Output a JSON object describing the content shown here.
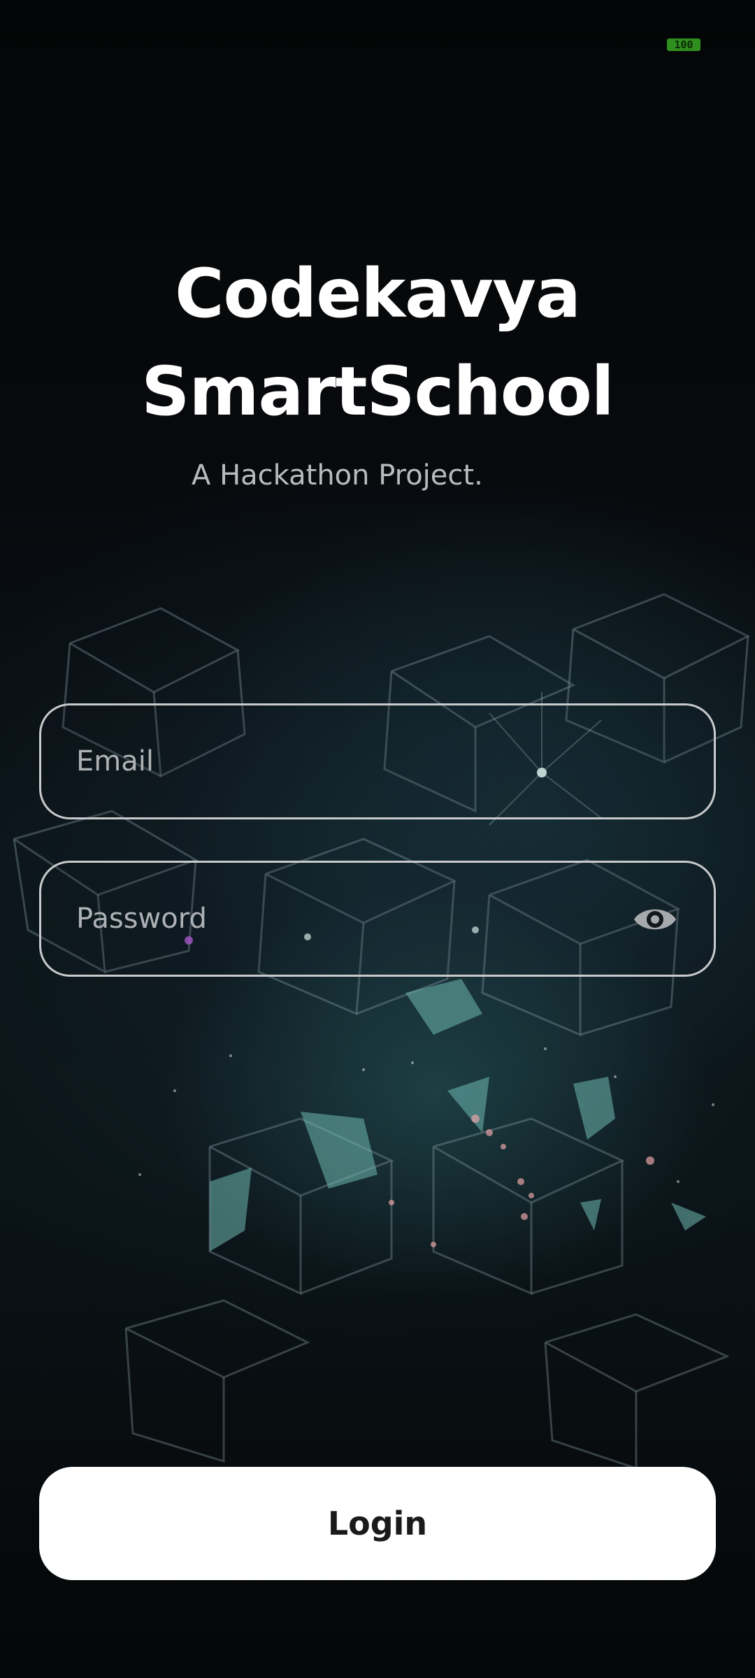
{
  "status_bar": {
    "battery_level": "100",
    "battery_color": "#2f8f1e"
  },
  "app": {
    "title_line1": "Codekavya",
    "title_line2": "SmartSchool",
    "subtitle": "A Hackathon Project."
  },
  "login_form": {
    "email_placeholder": "Email",
    "password_placeholder": "Password",
    "toggle_password_icon": "eye-icon",
    "login_label": "Login"
  },
  "colors": {
    "background": "#050608",
    "accent": "#ffffff",
    "field_border": "#c8cacc"
  }
}
